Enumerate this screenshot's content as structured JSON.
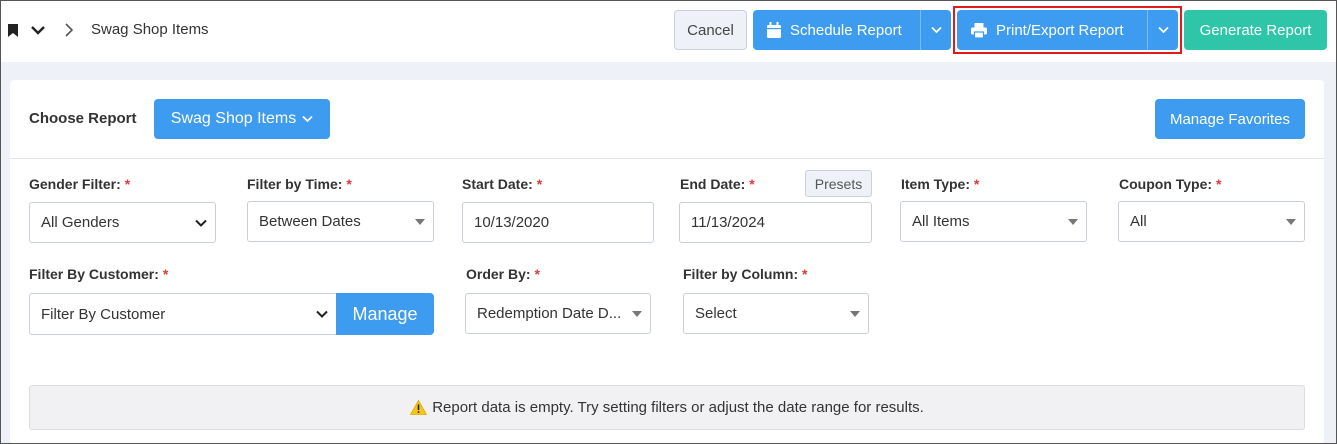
{
  "header": {
    "breadcrumb_title": "Swag Shop Items",
    "cancel_label": "Cancel",
    "schedule_label": "Schedule Report",
    "print_label": "Print/Export Report",
    "generate_label": "Generate Report"
  },
  "report": {
    "choose_label": "Choose Report",
    "selected_report": "Swag Shop Items",
    "favorites_label": "Manage Favorites"
  },
  "filters": {
    "gender": {
      "label": "Gender Filter:",
      "value": "All Genders"
    },
    "time": {
      "label": "Filter by Time:",
      "value": "Between Dates"
    },
    "start_date": {
      "label": "Start Date:",
      "value": "10/13/2020"
    },
    "end_date": {
      "label": "End Date:",
      "value": "11/13/2024"
    },
    "presets_label": "Presets",
    "item_type": {
      "label": "Item Type:",
      "value": "All Items"
    },
    "coupon_type": {
      "label": "Coupon Type:",
      "value": "All"
    },
    "customer": {
      "label": "Filter By Customer:",
      "value": "Filter By Customer"
    },
    "manage_label": "Manage",
    "order_by": {
      "label": "Order By:",
      "value": "Redemption Date D..."
    },
    "column": {
      "label": "Filter by Column:",
      "value": "Select"
    },
    "required_mark": "*"
  },
  "notice": {
    "text": "Report data is empty. Try setting filters or adjust the date range for results."
  },
  "colors": {
    "primary": "#3d9bf0",
    "success": "#2ec5a9",
    "required": "#e03b3b",
    "highlight": "#e01b1b",
    "warning": "#f5c518"
  },
  "icons": [
    "bookmark-icon",
    "chevron-down-icon",
    "chevron-right-icon",
    "calendar-icon",
    "printer-icon",
    "warning-icon"
  ]
}
